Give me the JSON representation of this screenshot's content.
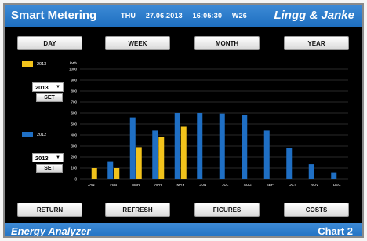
{
  "header": {
    "title": "Smart Metering",
    "day": "THU",
    "date": "27.06.2013",
    "time": "16:05:30",
    "week": "W26",
    "brand": "Lingg & Janke"
  },
  "period_buttons": {
    "day": "DAY",
    "week": "WEEK",
    "month": "MONTH",
    "year": "YEAR"
  },
  "legend": {
    "series1": {
      "label": "2013",
      "color": "#f2c31b",
      "selected": "2013",
      "set": "SET"
    },
    "series2": {
      "label": "2012",
      "color": "#1f6fc4",
      "selected": "2013",
      "set": "SET"
    }
  },
  "bottom_buttons": {
    "return": "RETURN",
    "refresh": "REFRESH",
    "figures": "FIGURES",
    "costs": "COSTS"
  },
  "footer": {
    "title": "Energy Analyzer",
    "right": "Chart 2"
  },
  "chart_data": {
    "type": "bar",
    "ylabel": "kWh",
    "ylim": [
      0,
      1000
    ],
    "yticks": [
      0,
      100,
      200,
      300,
      400,
      500,
      600,
      700,
      800,
      900,
      1000
    ],
    "categories": [
      "JAN",
      "FEB",
      "MAR",
      "APR",
      "MAY",
      "JUN",
      "JUL",
      "AUG",
      "SEP",
      "OCT",
      "NOV",
      "DEC"
    ],
    "series": [
      {
        "name": "2012",
        "color": "#1f6fc4",
        "values": [
          null,
          160,
          560,
          440,
          600,
          600,
          595,
          585,
          440,
          280,
          135,
          60
        ]
      },
      {
        "name": "2013",
        "color": "#f2c31b",
        "values": [
          100,
          100,
          290,
          380,
          475,
          null,
          null,
          null,
          null,
          null,
          null,
          null
        ]
      }
    ],
    "grid": true
  }
}
